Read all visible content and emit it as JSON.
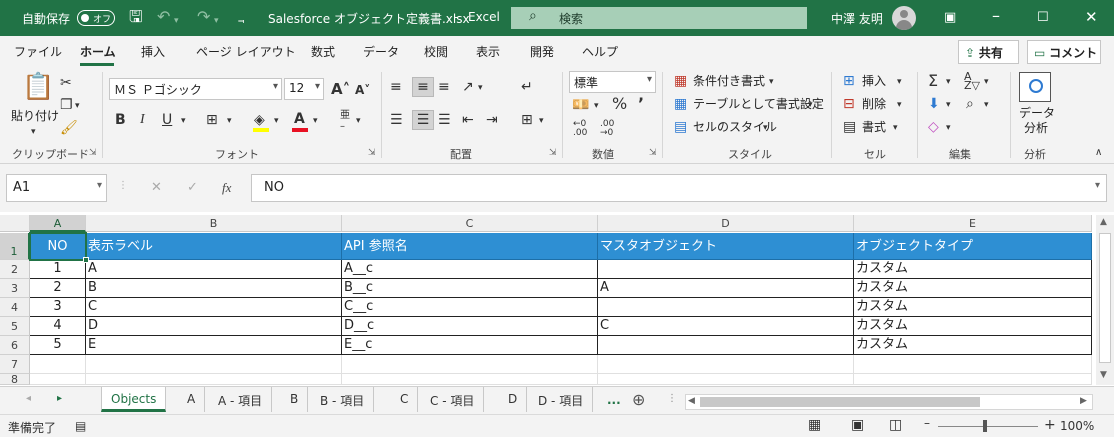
{
  "titlebar": {
    "autosave_label": "自動保存",
    "autosave_state": "オフ",
    "filename": "Salesforce オブジェクト定義書.xlsx",
    "separator": "-",
    "app_name": "Excel",
    "search_placeholder": "検索",
    "user_name": "中澤 友明",
    "bg_color": "#217346"
  },
  "ribbon_tabs": [
    "ファイル",
    "ホーム",
    "挿入",
    "ページ レイアウト",
    "数式",
    "データ",
    "校閲",
    "表示",
    "開発",
    "ヘルプ"
  ],
  "active_tab": "ホーム",
  "top_buttons": {
    "share": "共有",
    "comment": "コメント"
  },
  "ribbon": {
    "clipboard": {
      "label": "クリップボード",
      "paste": "貼り付け"
    },
    "font": {
      "label": "フォント",
      "font_name": "ＭＳ Ｐゴシック",
      "font_size": "12"
    },
    "alignment": {
      "label": "配置"
    },
    "number": {
      "label": "数値",
      "format": "標準"
    },
    "styles": {
      "label": "スタイル",
      "conditional": "条件付き書式",
      "as_table": "テーブルとして書式設定",
      "cell_styles": "セルのスタイル"
    },
    "cells": {
      "label": "セル",
      "insert": "挿入",
      "delete": "削除",
      "format": "書式"
    },
    "editing": {
      "label": "編集"
    },
    "analysis": {
      "label": "分析",
      "data_analysis_line1": "データ",
      "data_analysis_line2": "分析"
    }
  },
  "formula_bar": {
    "name_box": "A1",
    "content": "NO"
  },
  "columns": [
    "A",
    "B",
    "C",
    "D",
    "E"
  ],
  "rows": [
    "1",
    "2",
    "3",
    "4",
    "5",
    "6",
    "7",
    "8"
  ],
  "table": {
    "headers": [
      "NO",
      "表示ラベル",
      "API 参照名",
      "マスタオブジェクト",
      "オブジェクトタイプ"
    ],
    "rows": [
      [
        "1",
        "A",
        "A__c",
        "",
        "カスタム"
      ],
      [
        "2",
        "B",
        "B__c",
        "A",
        "カスタム"
      ],
      [
        "3",
        "C",
        "C__c",
        "",
        "カスタム"
      ],
      [
        "4",
        "D",
        "D__c",
        "C",
        "カスタム"
      ],
      [
        "5",
        "E",
        "E__c",
        "",
        "カスタム"
      ]
    ],
    "header_color": "#2e8fd3"
  },
  "sheet_tabs": [
    "Objects",
    "A",
    "A - 項目",
    "B",
    "B - 項目",
    "C",
    "C - 項目",
    "D",
    "D - 項目"
  ],
  "sheet_more": "...",
  "active_sheet": "Objects",
  "status": {
    "ready": "準備完了",
    "zoom": "100%"
  }
}
